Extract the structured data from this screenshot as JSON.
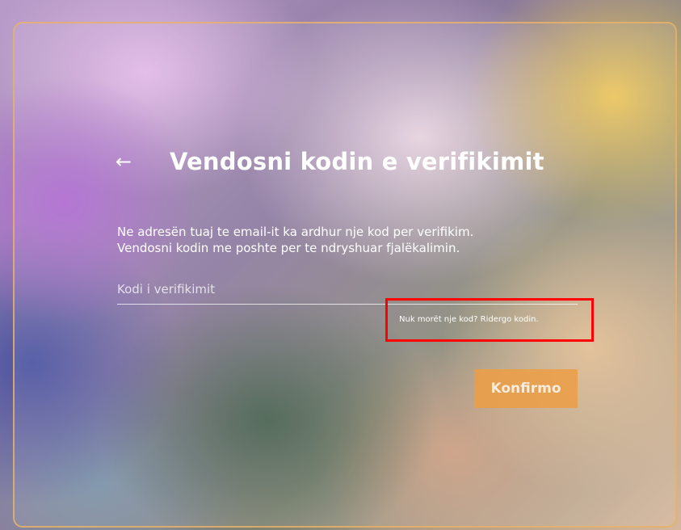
{
  "verify": {
    "back_icon": "arrow-left-icon",
    "back_glyph": "←",
    "title": "Vendosni kodin e verifikimit",
    "description_line1": "Ne adresën tuaj te email-it ka ardhur nje kod per verifikim.",
    "description_line2": "Vendosni kodin me poshte per te ndryshuar fjalëkalimin.",
    "code_placeholder": "Kodi i verifikimit",
    "code_value": "",
    "resend_text": "Nuk morët nje kod? Ridergo kodin.",
    "confirm_label": "Konfirmo"
  },
  "colors": {
    "card_border": "#e8b068",
    "button_bg": "#ec9e44",
    "highlight_box": "#ff0000",
    "text": "#ffffff"
  }
}
